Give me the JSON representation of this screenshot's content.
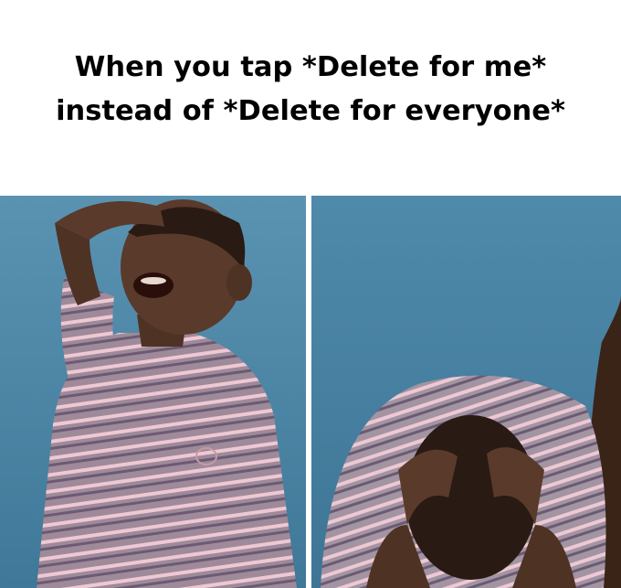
{
  "meme": {
    "caption_line_1": "When you tap *Delete for me*",
    "caption_line_2": "instead of *Delete for everyone*"
  },
  "colors": {
    "background": "#ffffff",
    "wall": "#4d86a6",
    "skin": "#5a3a2a",
    "shirt_base": "#9e8a98",
    "shirt_stripe_light": "#eec8d4",
    "shirt_stripe_dark": "#6b5a74"
  }
}
